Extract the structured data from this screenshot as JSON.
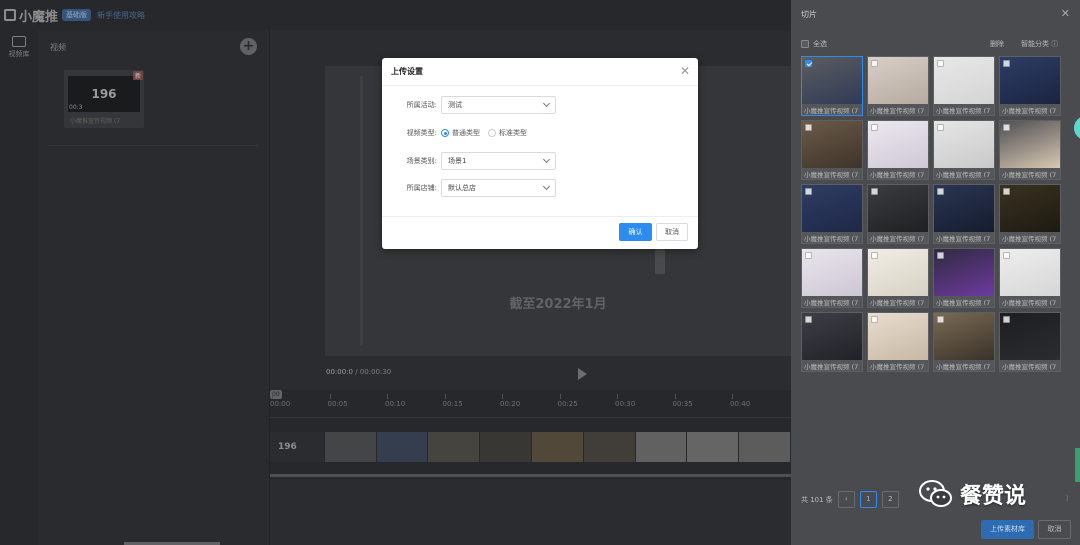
{
  "app": {
    "logo_text": "小魔推",
    "badge": "基础版",
    "top_link": "新手使用攻略",
    "rail_label": "视频库"
  },
  "left_panel": {
    "title": "视频",
    "card_thumb_text": "196",
    "card_tag": "新",
    "card_timecode": "00:3",
    "card_label": "小魔推宣传视频 (7"
  },
  "preview": {
    "caption": "截至2022年1月",
    "time_current": "00:00:0",
    "time_total": "/ 00:00:30"
  },
  "timeline": {
    "playhead": "00",
    "ticks": [
      "00:00",
      "00:05",
      "00:10",
      "00:15",
      "00:20",
      "00:25",
      "00:30",
      "00:35",
      "00:40"
    ],
    "track_label": "196"
  },
  "modal": {
    "title": "上传设置",
    "fields": [
      {
        "label": "所属活动:",
        "value": "测试"
      },
      {
        "label": "场景类别:",
        "value": "场景1"
      },
      {
        "label": "所属店铺:",
        "value": "默认总店"
      }
    ],
    "video_type": {
      "label": "视频类型:",
      "options": [
        "普通类型",
        "标准类型"
      ],
      "selected": "普通类型"
    },
    "confirm": "确认",
    "cancel": "取消"
  },
  "drawer": {
    "title": "切片",
    "select_all": "全选",
    "delete": "删除",
    "smart_classify": "智能分类",
    "clip_label": "小魔推宣传视频 (7",
    "total": "共 101 条",
    "pages": [
      "1",
      "2"
    ],
    "current_page": "1",
    "upload_button": "上传素材库",
    "cancel_button": "取消",
    "selected_clip": 1
  },
  "watermark": "餐赞说",
  "colors": {
    "primary": "#2d8cf0",
    "drawer_bg": "#4a4b4e",
    "app_bg": "#2f3033"
  }
}
